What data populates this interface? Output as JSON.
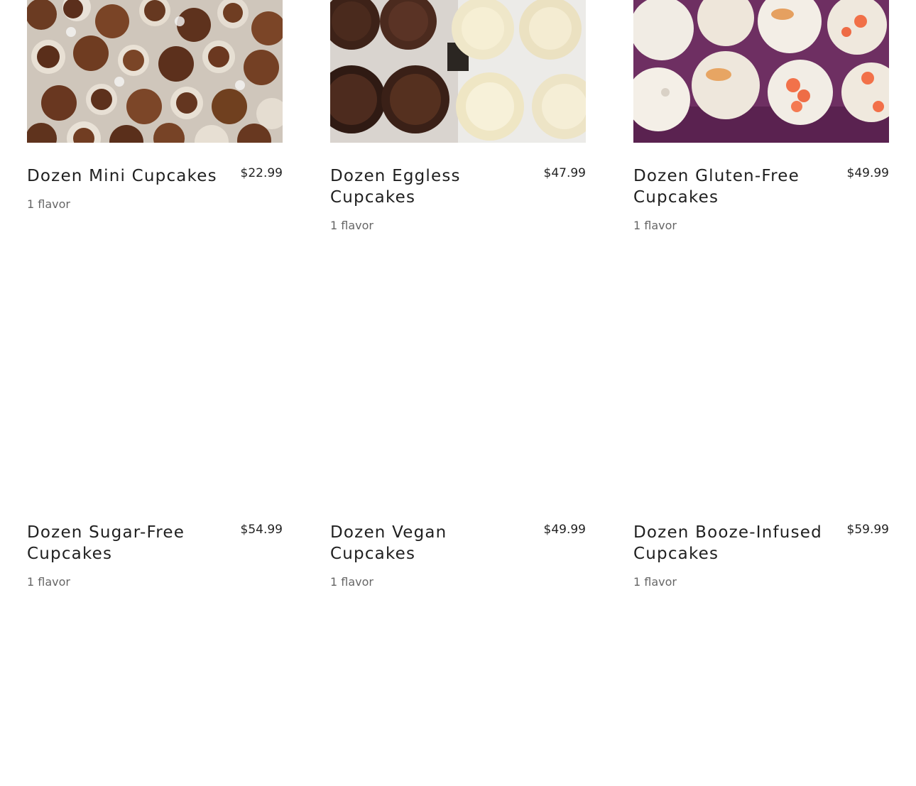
{
  "products_row1": [
    {
      "name": "Dozen Mini Cupcakes",
      "price": "$22.99",
      "description": "1 flavor",
      "image": "chocolate-mini-cupcakes"
    },
    {
      "name": "Dozen Eggless Cupcakes",
      "price": "$47.99",
      "description": "1 flavor",
      "image": "chocolate-and-vanilla-cupcakes"
    },
    {
      "name": "Dozen Gluten-Free Cupcakes",
      "price": "$49.99",
      "description": "1 flavor",
      "image": "cream-and-orange-crumble-cupcakes"
    }
  ],
  "products_row2": [
    {
      "name": "Dozen Sugar-Free Cupcakes",
      "price": "$54.99",
      "description": "1 flavor"
    },
    {
      "name": "Dozen Vegan Cupcakes",
      "price": "$49.99",
      "description": "1 flavor"
    },
    {
      "name": "Dozen Booze-Infused Cupcakes",
      "price": "$59.99",
      "description": "1 flavor"
    }
  ],
  "colors": {
    "title": "#1f1f1f",
    "price": "#222222",
    "description": "#666666",
    "chocolate": "#5a3220",
    "frosting_cream": "#f3ead2",
    "purple_tray": "#7a3a6e",
    "orange_crumble": "#f0714a"
  }
}
